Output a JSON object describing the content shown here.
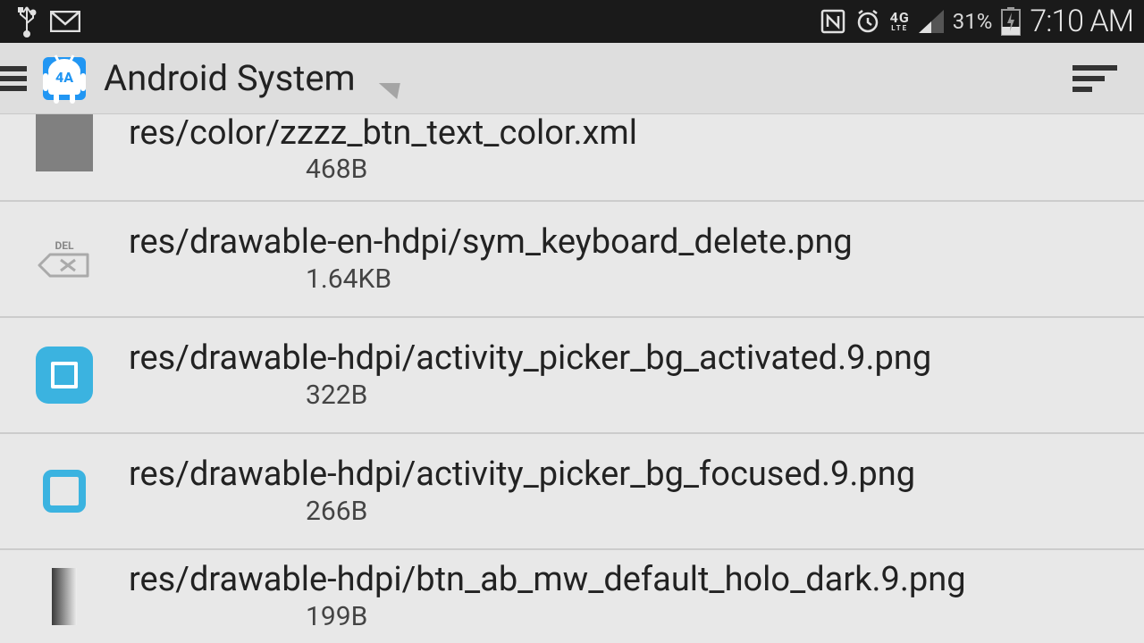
{
  "status_bar": {
    "network": "4G",
    "network_sub": "LTE",
    "battery_pct": "31%",
    "time": "7:10 AM"
  },
  "app_bar": {
    "title": "Android System",
    "icon_label": "4A"
  },
  "files": [
    {
      "path": "res/color/zzzz_btn_text_color.xml",
      "size": "468B"
    },
    {
      "path": "res/drawable-en-hdpi/sym_keyboard_delete.png",
      "size": "1.64KB"
    },
    {
      "path": "res/drawable-hdpi/activity_picker_bg_activated.9.png",
      "size": "322B"
    },
    {
      "path": "res/drawable-hdpi/activity_picker_bg_focused.9.png",
      "size": "266B"
    },
    {
      "path": "res/drawable-hdpi/btn_ab_mw_default_holo_dark.9.png",
      "size": "199B"
    }
  ]
}
